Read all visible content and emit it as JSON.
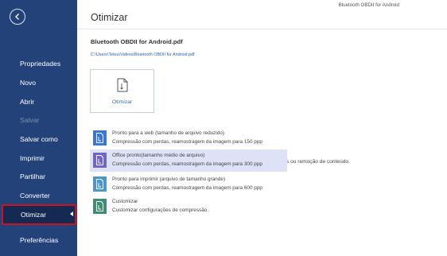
{
  "app": {
    "title": "Bluetooth OBDII for Android"
  },
  "sidebar": {
    "items": [
      {
        "label": "Propriedades"
      },
      {
        "label": "Novo"
      },
      {
        "label": "Abrir"
      },
      {
        "label": "Salvar"
      },
      {
        "label": "Salvar como"
      },
      {
        "label": "Imprimir"
      },
      {
        "label": "Partilhar"
      },
      {
        "label": "Converter"
      },
      {
        "label": "Otimizar"
      },
      {
        "label": "Preferências"
      }
    ],
    "active": "Otimizar",
    "disabled": [
      "Salvar"
    ]
  },
  "main": {
    "title": "Otimizar",
    "document": {
      "name": "Bluetooth OBDII for Android.pdf",
      "path": "C:\\Users\\Teteu\\Videos\\Bluetooth OBDII for Android.pdf"
    },
    "optimize_card": {
      "label": "Otimizar",
      "description": "Compactar arquivos através da compressão de imagens ou remoção de conteúdo."
    },
    "options": [
      {
        "title": "Pronto para a web (tamanho de arquivo reduzido)",
        "subtitle": "Compressão com perdas, reamostragem da imagem para 150 ppp",
        "icon": "web-file-icon",
        "color": "#3a76d6"
      },
      {
        "title": "Office pronto(tamanho médio de arquivo)",
        "subtitle": "Compressão com perdas, reamostragem da imagem para 300 ppp",
        "icon": "office-file-icon",
        "color": "#7265c6",
        "selected": true
      },
      {
        "title": "Pronto para imprimir (arquivo de tamanho grande)",
        "subtitle": "Compressão com perdas, reamostragem da imagem para 600 ppp",
        "icon": "print-file-icon",
        "color": "#4b97cc"
      },
      {
        "title": "Customizar",
        "subtitle": "Customizar configurações de compressão.",
        "icon": "custom-file-icon",
        "color": "#3f8d73"
      }
    ]
  },
  "colors": {
    "sidebar": "#23427a",
    "active_item": "#152a52",
    "highlight_border": "#d0121b",
    "selected_row": "#dde2f6",
    "link": "#2a62b8"
  }
}
